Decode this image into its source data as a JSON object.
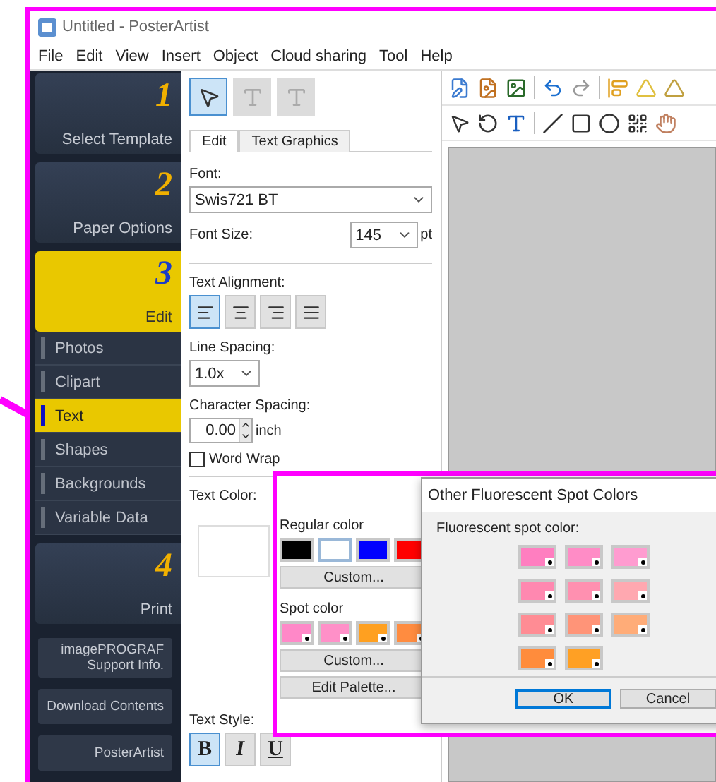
{
  "window": {
    "title": "Untitled - PosterArtist"
  },
  "menu": [
    "File",
    "Edit",
    "View",
    "Insert",
    "Object",
    "Cloud sharing",
    "Tool",
    "Help"
  ],
  "sidebar": {
    "steps": [
      {
        "number": "1",
        "label": "Select Template",
        "selected": false
      },
      {
        "number": "2",
        "label": "Paper Options",
        "selected": false
      },
      {
        "number": "3",
        "label": "Edit",
        "selected": true,
        "children": [
          {
            "label": "Photos",
            "selected": false
          },
          {
            "label": "Clipart",
            "selected": false
          },
          {
            "label": "Text",
            "selected": true
          },
          {
            "label": "Shapes",
            "selected": false
          },
          {
            "label": "Backgrounds",
            "selected": false
          },
          {
            "label": "Variable Data",
            "selected": false
          }
        ]
      },
      {
        "number": "4",
        "label": "Print",
        "selected": false
      }
    ],
    "links": [
      {
        "lines": [
          "imagePROGRAF",
          "Support Info."
        ]
      },
      {
        "lines": [
          "Download Contents"
        ]
      },
      {
        "lines": [
          "PosterArtist"
        ]
      }
    ]
  },
  "panel": {
    "tools": [
      {
        "kind": "select",
        "selected": true,
        "disabled": false
      },
      {
        "kind": "text",
        "selected": false,
        "disabled": true
      },
      {
        "kind": "vertical-text",
        "selected": false,
        "disabled": true
      }
    ],
    "tabs": [
      {
        "label": "Edit",
        "selected": true
      },
      {
        "label": "Text Graphics",
        "selected": false
      }
    ],
    "font": {
      "label": "Font:",
      "value": "Swis721 BT"
    },
    "font_size": {
      "label": "Font Size:",
      "value": "145",
      "unit": "pt"
    },
    "alignment": {
      "label": "Text Alignment:",
      "options": [
        {
          "kind": "left",
          "selected": true
        },
        {
          "kind": "center",
          "selected": false
        },
        {
          "kind": "right",
          "selected": false
        },
        {
          "kind": "justify",
          "selected": false
        }
      ]
    },
    "line_spacing": {
      "label": "Line Spacing:",
      "value": "1.0x"
    },
    "character_spacing": {
      "label": "Character Spacing:",
      "value": "0.00",
      "unit": "inch"
    },
    "word_wrap": {
      "label": "Word Wrap",
      "checked": false
    },
    "text_color": {
      "label": "Text Color:"
    },
    "text_style": {
      "label": "Text Style:",
      "options": [
        {
          "label": "B",
          "kind": "bold",
          "selected": true
        },
        {
          "label": "I",
          "kind": "italic",
          "selected": false
        },
        {
          "label": "U",
          "kind": "underline",
          "selected": false
        }
      ]
    }
  },
  "color_popup": {
    "regular_label": "Regular color",
    "regular_colors": [
      {
        "color": "#000000",
        "selected": false
      },
      {
        "color": "#ffffff",
        "selected": true
      },
      {
        "color": "#0000ff",
        "selected": false
      },
      {
        "color": "#ff0000",
        "selected": false
      }
    ],
    "custom_label": "Custom...",
    "spot_label": "Spot color",
    "spot_colors": [
      {
        "color": "#ff88c8"
      },
      {
        "color": "#ff90c8"
      },
      {
        "color": "#ffa020"
      },
      {
        "color": "#ff8c40"
      }
    ],
    "spot_custom_label": "Custom...",
    "edit_palette_label": "Edit Palette..."
  },
  "dialog": {
    "title": "Other Fluorescent Spot Colors",
    "label": "Fluorescent spot color:",
    "colors": [
      {
        "color": "#ff7ec0"
      },
      {
        "color": "#ff8cc6"
      },
      {
        "color": "#ff9cd0"
      },
      {
        "color": "#ff88b0"
      },
      {
        "color": "#ff90b0"
      },
      {
        "color": "#ffa8b0"
      },
      {
        "color": "#ff8c94"
      },
      {
        "color": "#ff9478"
      },
      {
        "color": "#ffac78"
      },
      {
        "color": "#ff8c3c"
      },
      {
        "color": "#ffa024"
      }
    ],
    "buttons": [
      {
        "label": "OK",
        "focused": true
      },
      {
        "label": "Cancel",
        "focused": false
      }
    ]
  }
}
